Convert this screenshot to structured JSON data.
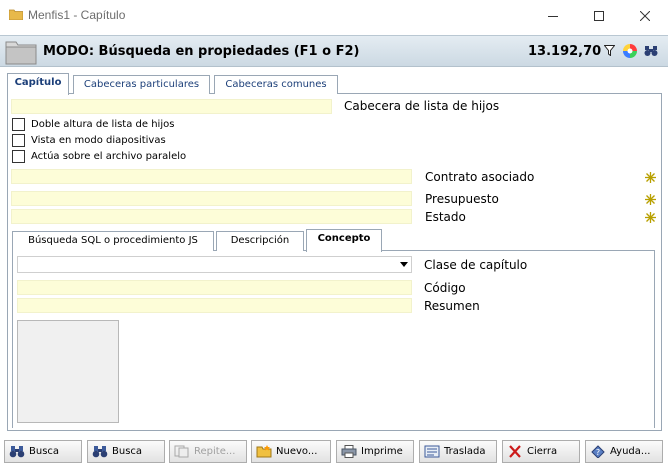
{
  "window": {
    "title": "Menfis1 - Capítulo"
  },
  "header": {
    "mode": "MODO: Búsqueda en propiedades (F1 o F2)",
    "amount": "13.192,70"
  },
  "tabs": [
    "Capítulo",
    "Cabeceras particulares",
    "Cabeceras comunes"
  ],
  "fields": {
    "children_list_header": "Cabecera de lista de hijos",
    "contract": "Contrato asociado",
    "budget": "Presupuesto",
    "state": "Estado"
  },
  "checkboxes": [
    "Doble altura de lista de hijos",
    "Vista en modo diapositivas",
    "Actúa sobre el archivo paralelo"
  ],
  "inner_tabs": [
    "Búsqueda SQL o procedimiento JS",
    "Descripción",
    "Concepto"
  ],
  "concept": {
    "chapter_class": "Clase de capítulo",
    "code": "Código",
    "summary": "Resumen"
  },
  "buttons": {
    "search1": "Busca",
    "search2": "Busca",
    "repeat": "Repite...",
    "new": "Nuevo...",
    "print": "Imprime",
    "move": "Traslada",
    "close": "Cierra",
    "help": "Ayuda..."
  }
}
